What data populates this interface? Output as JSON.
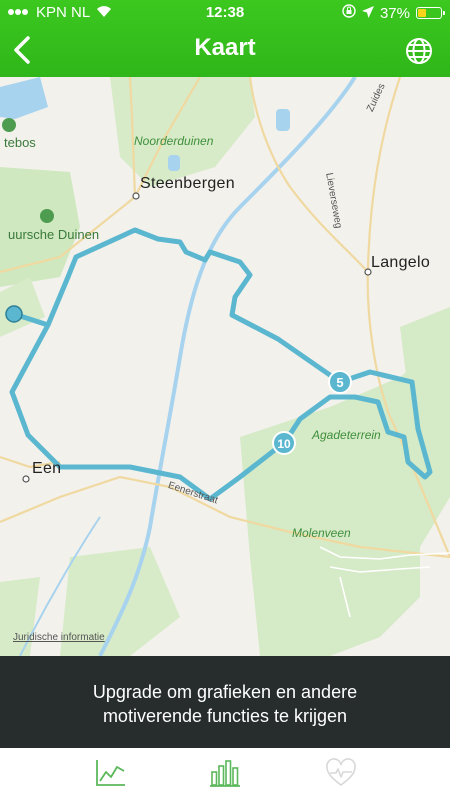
{
  "status_bar": {
    "carrier": "KPN NL",
    "time": "12:38",
    "battery": "37%",
    "battery_level": 0.37
  },
  "header": {
    "title": "Kaart"
  },
  "map": {
    "places": {
      "steenbergen": "Steenbergen",
      "langelo": "Langelo",
      "een": "Een",
      "noorderduinen": "Noorderduinen",
      "nuursche_duinen": "uursche Duinen",
      "tebos": "tebos",
      "agadeterrein": "Agadeterrein",
      "molenveen": "Molenveen",
      "lieverseweg": "Lieverseweg",
      "zuides": "Zuides",
      "road_bottom": "Eenerstraat"
    },
    "markers": [
      "5",
      "10"
    ],
    "legal_link": "Juridische informatie"
  },
  "banner": {
    "line1": "Upgrade om grafieken en andere",
    "line2": "motiverende functies te krijgen"
  },
  "tabbar": {
    "icons": [
      "chart-line-icon",
      "bar-chart-icon",
      "heart-rate-icon"
    ]
  },
  "colors": {
    "header_green": "#33bb1c",
    "route": "#5bb7cf",
    "banner_bg": "#272c2c",
    "tab_green": "#5cb85c"
  }
}
